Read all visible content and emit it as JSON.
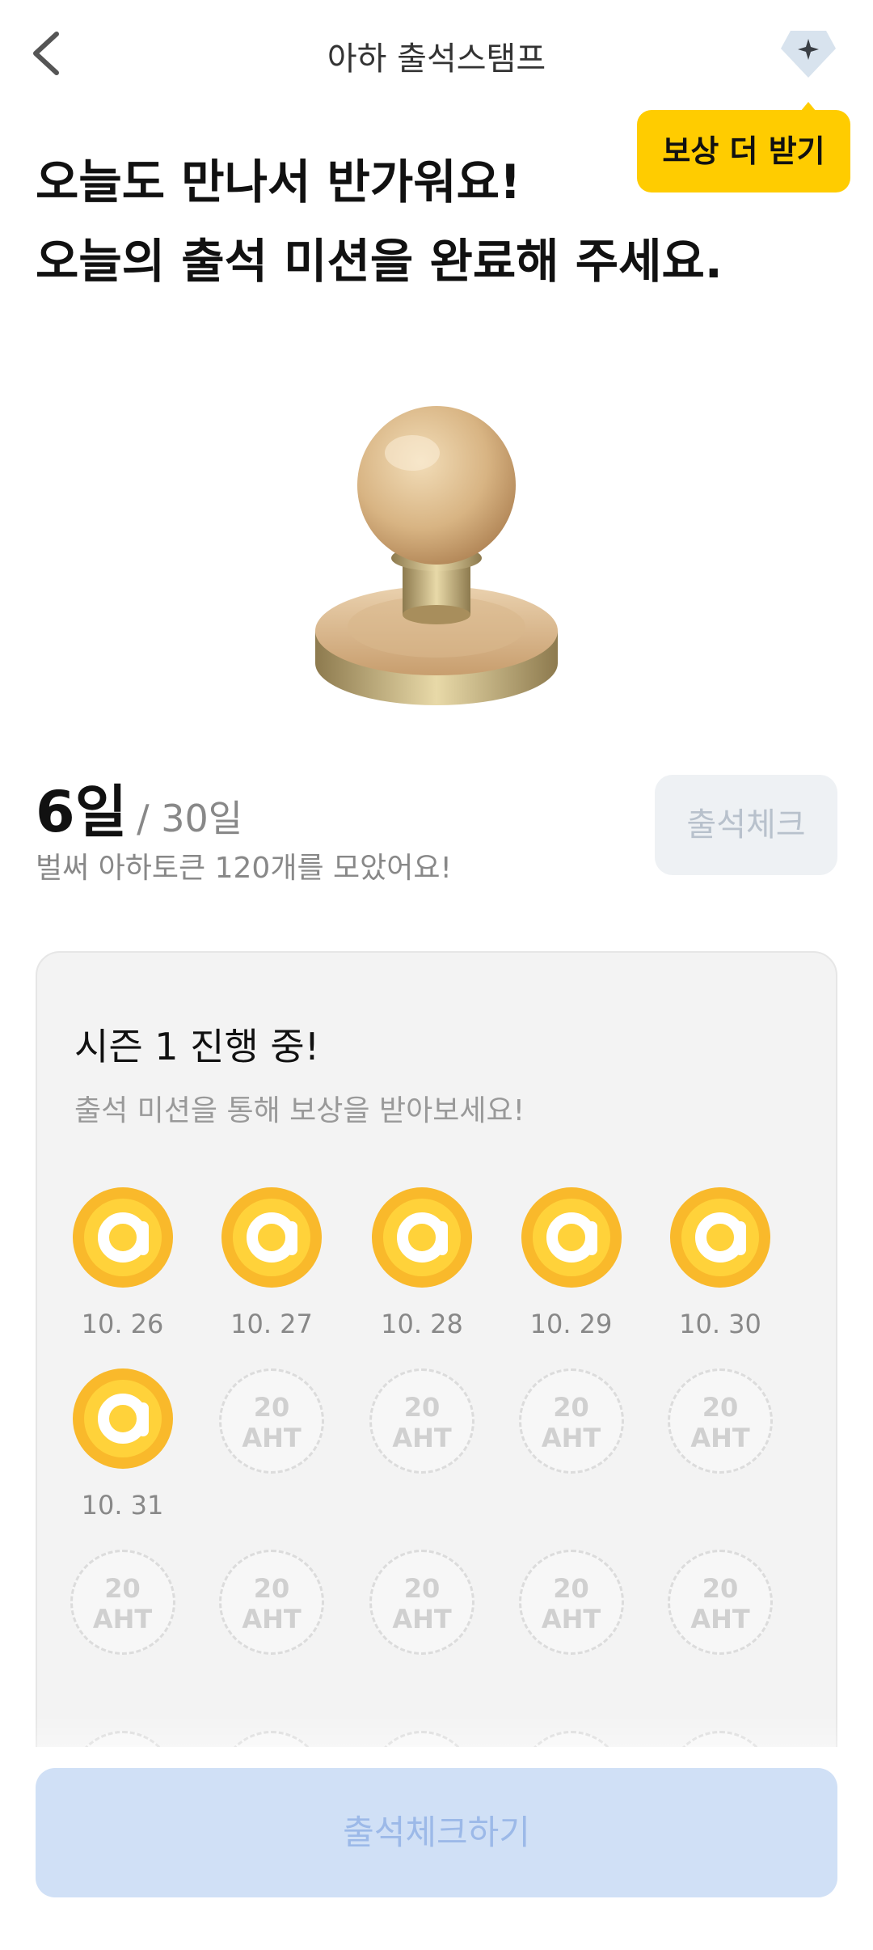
{
  "header": {
    "title": "아하 출석스탬프",
    "back_icon": "chevron-left-icon",
    "gem_icon": "sparkle-gem-icon",
    "reward_tooltip": "보상 더 받기",
    "tooltip_color": "#FFCC00"
  },
  "headline": {
    "line1": "오늘도 만나서 반가워요!",
    "line2": "오늘의 출석 미션을 완료해 주세요."
  },
  "stamp": {
    "icon": "wooden-stamp-icon"
  },
  "progress": {
    "days": "6일",
    "total": "/ 30일",
    "subtitle": "벌써 아하토큰 120개를 모았어요!",
    "check_button": "출석체크"
  },
  "season": {
    "title": "시즌 1 진행 중!",
    "subtitle": "출석 미션을 통해 보상을 받아보세요!",
    "collected": [
      {
        "date": "10. 26"
      },
      {
        "date": "10. 27"
      },
      {
        "date": "10. 28"
      },
      {
        "date": "10. 29"
      },
      {
        "date": "10. 30"
      },
      {
        "date": "10. 31"
      }
    ],
    "reward_amount": "20",
    "reward_unit": "AHT",
    "coin_color": "#F9B92B"
  },
  "bottom": {
    "button_label": "출석체크하기",
    "button_color": "#D0E0F6"
  }
}
